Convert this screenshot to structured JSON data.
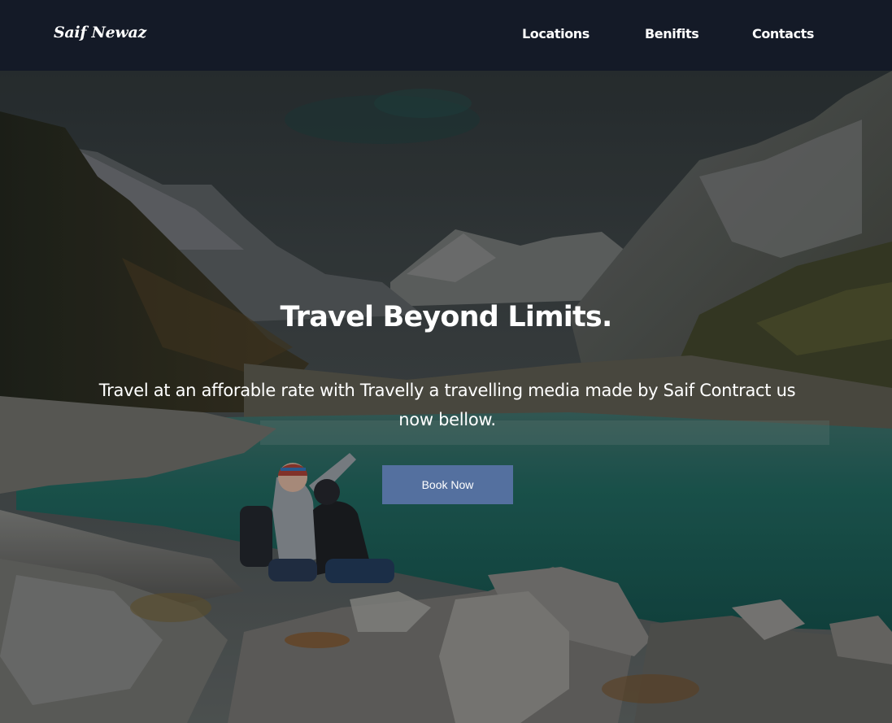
{
  "navbar": {
    "brand": "Saif Newaz",
    "links": [
      "Locations",
      "Benifits",
      "Contacts"
    ]
  },
  "hero": {
    "title": "Travel Beyond Limits.",
    "subtitle": "Travel at an afforable rate with Travelly a travelling media made by Saif Contract us now bellow.",
    "button_label": "Book Now"
  },
  "colors": {
    "navbar_bg": "#141a27",
    "button_bg": "#54709f",
    "text": "#ffffff"
  }
}
